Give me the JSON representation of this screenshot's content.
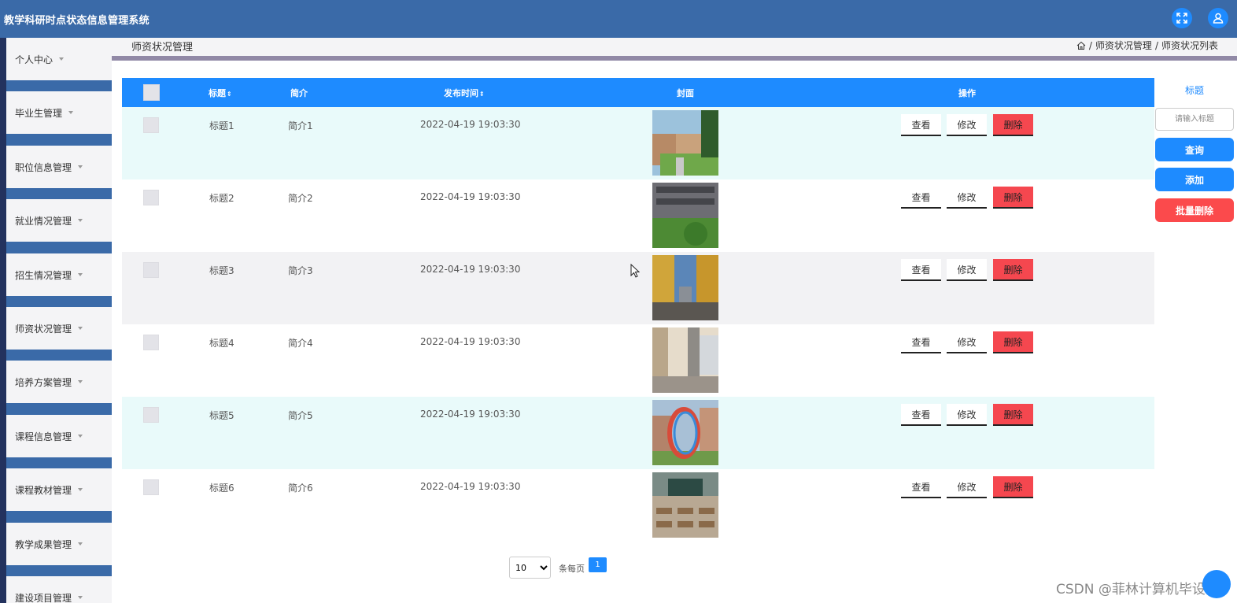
{
  "header": {
    "title": "教学科研时点状态信息管理系统",
    "fullscreen_icon": "expand-icon",
    "user_icon": "user-icon"
  },
  "sidebar": {
    "items": [
      {
        "label": "个人中心"
      },
      {
        "label": "毕业生管理"
      },
      {
        "label": "职位信息管理"
      },
      {
        "label": "就业情况管理"
      },
      {
        "label": "招生情况管理"
      },
      {
        "label": "师资状况管理"
      },
      {
        "label": "培养方案管理"
      },
      {
        "label": "课程信息管理"
      },
      {
        "label": "课程教材管理"
      },
      {
        "label": "教学成果管理"
      },
      {
        "label": "建设项目管理"
      }
    ]
  },
  "page": {
    "title": "师资状况管理",
    "breadcrumb": {
      "level1": "师资状况管理",
      "level2": "师资状况列表",
      "sep": "/"
    }
  },
  "table": {
    "headers": {
      "title": "标题",
      "intro": "简介",
      "time": "发布时间",
      "cover": "封面",
      "actions": "操作"
    },
    "actions": {
      "view": "查看",
      "edit": "修改",
      "delete": "删除"
    },
    "rows": [
      {
        "title": "标题1",
        "intro": "简介1",
        "time": "2022-04-19 19:03:30",
        "cover": "campus-building-lawn"
      },
      {
        "title": "标题2",
        "intro": "简介2",
        "time": "2022-04-19 19:03:30",
        "cover": "campus-building-shrubs"
      },
      {
        "title": "标题3",
        "intro": "简介3",
        "time": "2022-04-19 19:03:30",
        "cover": "ginkgo-avenue"
      },
      {
        "title": "标题4",
        "intro": "简介4",
        "time": "2022-04-19 19:03:30",
        "cover": "school-corridor"
      },
      {
        "title": "标题5",
        "intro": "简介5",
        "time": "2022-04-19 19:03:30",
        "cover": "ring-sculpture"
      },
      {
        "title": "标题6",
        "intro": "简介6",
        "time": "2022-04-19 19:03:30",
        "cover": "classroom"
      }
    ]
  },
  "search": {
    "label": "标题",
    "placeholder": "请输入标题",
    "query_label": "查询",
    "add_label": "添加",
    "batch_delete_label": "批量删除"
  },
  "pagination": {
    "page_size": "10",
    "per_page_label": "条每页",
    "current_page": "1"
  },
  "watermark": "CSDN @菲林计算机毕设",
  "colors": {
    "primary": "#1e8bff",
    "danger": "#f5474f",
    "header": "#3a6aa8"
  }
}
